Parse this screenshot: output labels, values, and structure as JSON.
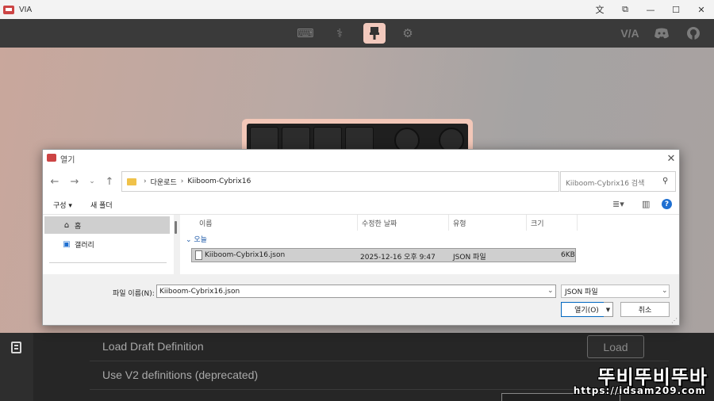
{
  "window": {
    "title": "VIA",
    "icons": [
      "translate-icon",
      "extension-icon",
      "minimize-icon",
      "maximize-icon",
      "close-icon"
    ]
  },
  "topnav": {
    "icons": [
      "keyboard-icon",
      "stethoscope-icon",
      "brush-icon",
      "gear-icon"
    ],
    "active": "brush-icon",
    "right_logo": "V/A",
    "right_icons": [
      "discord-icon",
      "github-icon"
    ]
  },
  "colors": {
    "accent": "#f2c9bd",
    "dialog_bg": "#f0f0f0",
    "link": "#1e5aa8",
    "dark_bg": "#262626"
  },
  "dialog": {
    "title": "열기",
    "address": {
      "crumbs": [
        "다운로드",
        "Kiiboom-Cybrix16"
      ]
    },
    "search_placeholder": "Kiiboom-Cybrix16 검색",
    "toolbar": {
      "organize": "구성 ▾",
      "new_folder": "새 폴더"
    },
    "nav": [
      {
        "label": "홈",
        "icon": "home-icon"
      },
      {
        "label": "갤러리",
        "icon": "gallery-icon"
      }
    ],
    "columns": {
      "name": "이름",
      "modified": "수정한 날짜",
      "type": "유형",
      "size": "크기"
    },
    "group_label": "오늘",
    "files": [
      {
        "name": "Kiiboom-Cybrix16.json",
        "modified": "2025-12-16 오후 9:47",
        "type": "JSON 파일",
        "size": "6KB"
      }
    ],
    "filename_label": "파일 이름(N):",
    "filename_value": "Kiiboom-Cybrix16.json",
    "filetype": "JSON 파일",
    "open_label": "열기(O)",
    "cancel_label": "취소"
  },
  "bottom": {
    "rows": [
      "Load Draft Definition",
      "Use V2 definitions (deprecated)"
    ],
    "load_button": "Load"
  },
  "watermark": {
    "main": "뚜비뚜비뚜바",
    "sub": "https://idsam209.com"
  }
}
